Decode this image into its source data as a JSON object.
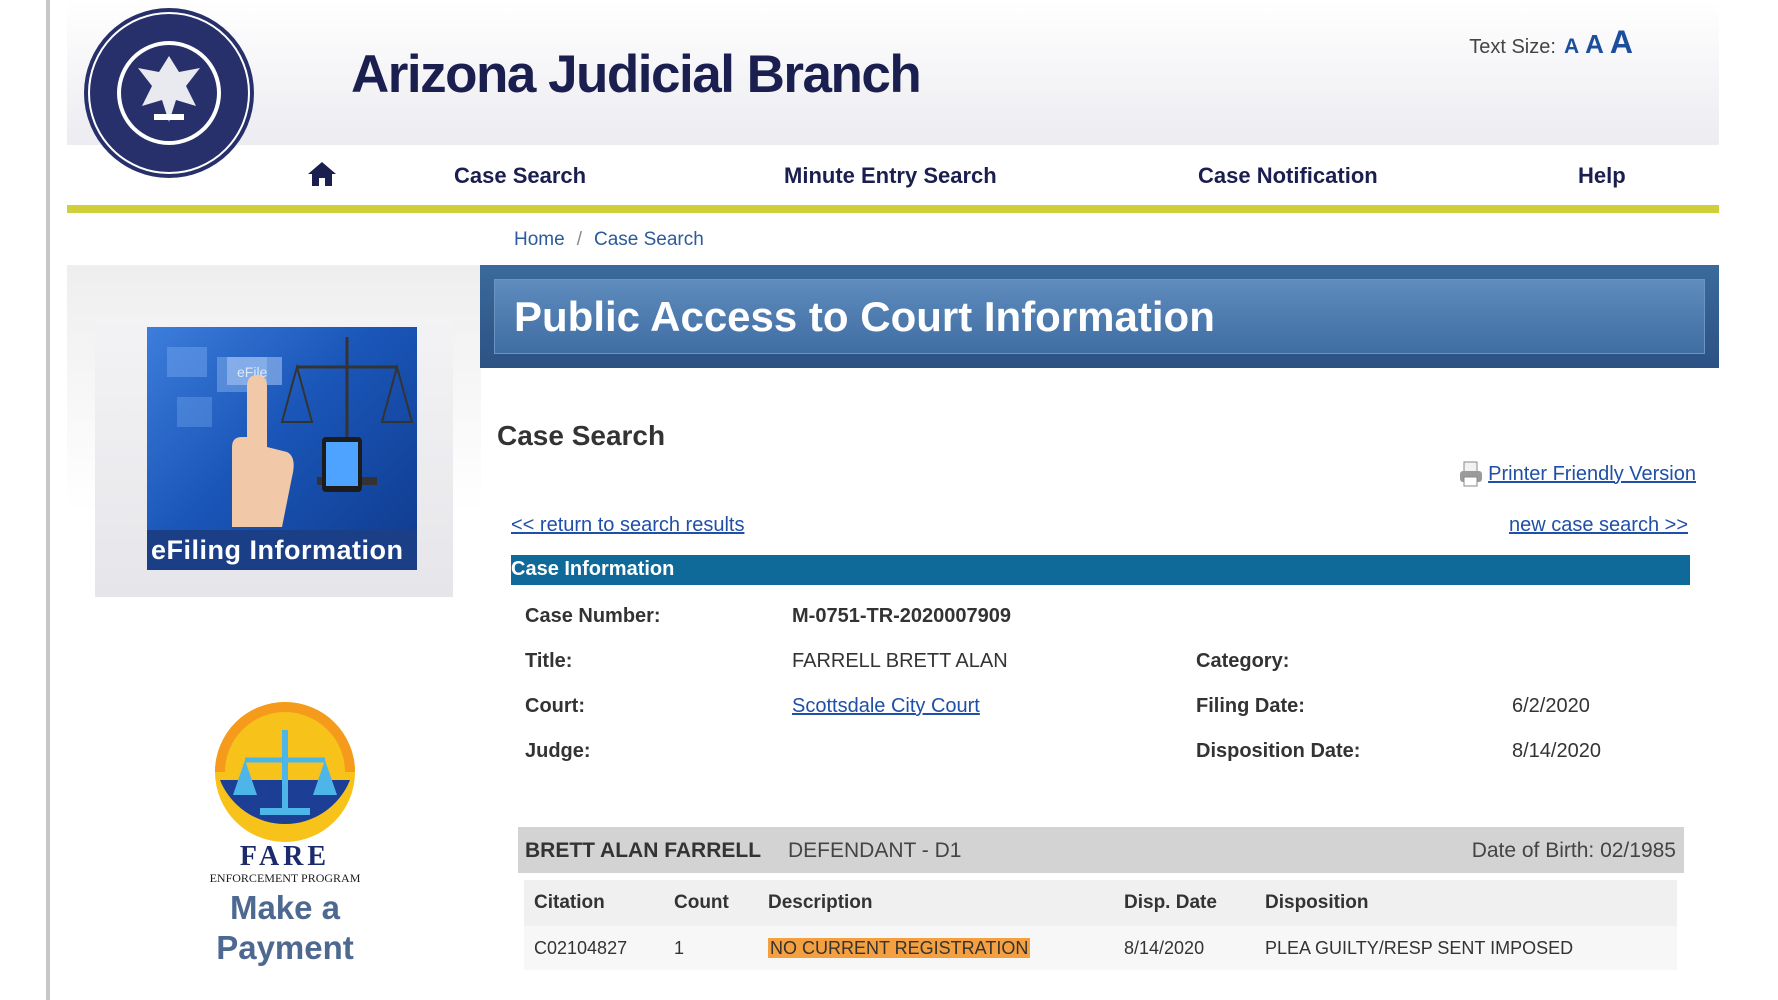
{
  "header": {
    "site_title": "Arizona Judicial Branch",
    "text_size_label": "Text Size:",
    "text_size_small": "A",
    "text_size_medium": "A",
    "text_size_large": "A"
  },
  "nav": {
    "items": [
      {
        "label": "Case Search"
      },
      {
        "label": "Minute Entry Search"
      },
      {
        "label": "Case Notification"
      },
      {
        "label": "Help"
      }
    ]
  },
  "breadcrumb": {
    "home": "Home",
    "separator": "/",
    "current": "Case Search"
  },
  "sidebar": {
    "efile_label": "eFiling  Information",
    "efile_overlay": "eFile",
    "fare_program": "ENFORCEMENT PROGRAM",
    "fare_text": "FARE",
    "payment_label": "Make a Payment"
  },
  "main": {
    "banner_title": "Public Access to Court Information",
    "section_title": "Case Search",
    "printer_link": "Printer Friendly Version",
    "return_link": "<< return to search results",
    "new_search_link": "new case search >>",
    "case_info_heading": "Case Information"
  },
  "case_info": {
    "case_number_label": "Case Number:",
    "case_number": "M-0751-TR-2020007909",
    "title_label": "Title:",
    "title": "FARRELL BRETT ALAN",
    "category_label": "Category:",
    "court_label": "Court:",
    "court": "Scottsdale City Court",
    "filing_date_label": "Filing Date:",
    "filing_date": "6/2/2020",
    "judge_label": "Judge:",
    "disposition_date_label": "Disposition Date:",
    "disposition_date": "8/14/2020"
  },
  "party": {
    "name": "BRETT ALAN FARRELL",
    "role": "DEFENDANT  -  D1",
    "dob": "Date of Birth: 02/1985"
  },
  "charges": {
    "headers": [
      "Citation",
      "Count",
      "Description",
      "Disp. Date",
      "Disposition"
    ],
    "rows": [
      [
        "C02104827",
        "1",
        "NO CURRENT REGISTRATION",
        "8/14/2020",
        "PLEA GUILTY/RESP SENT IMPOSED"
      ]
    ]
  },
  "colors": {
    "title_navy": "#1b1f4f",
    "nav_underline": "#cfcf3a",
    "banner_blue": "#3f6ea3",
    "case_info_bar": "#0f6a9a",
    "link_blue": "#1f4fa8",
    "highlight_orange": "#f5a040"
  }
}
